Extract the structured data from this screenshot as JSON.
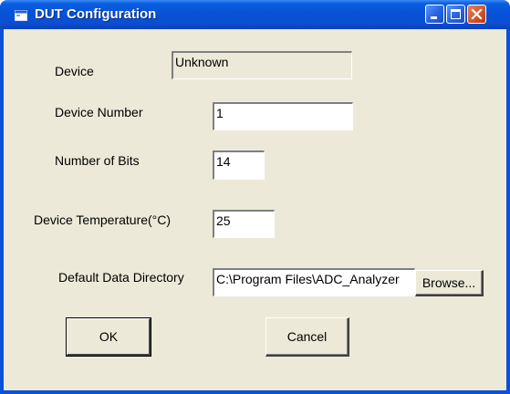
{
  "window": {
    "title": "DUT Configuration",
    "icon": "app-window-icon"
  },
  "titlebar_buttons": {
    "minimize": "minimize-icon",
    "maximize": "maximize-icon",
    "close": "close-icon"
  },
  "form": {
    "device_label": "Device",
    "device_value": "Unknown",
    "device_number_label": "Device Number",
    "device_number_value": "1",
    "bits_label": "Number of Bits",
    "bits_value": "14",
    "temperature_label": "Device Temperature(°C)",
    "temperature_value": "25",
    "directory_label": "Default Data Directory",
    "directory_value": "C:\\Program Files\\ADC_Analyzer",
    "browse_label": "Browse..."
  },
  "buttons": {
    "ok_label": "OK",
    "cancel_label": "Cancel"
  },
  "colors": {
    "titlebar": "#0a52d8",
    "face": "#ece9d8",
    "close": "#d4562a"
  }
}
